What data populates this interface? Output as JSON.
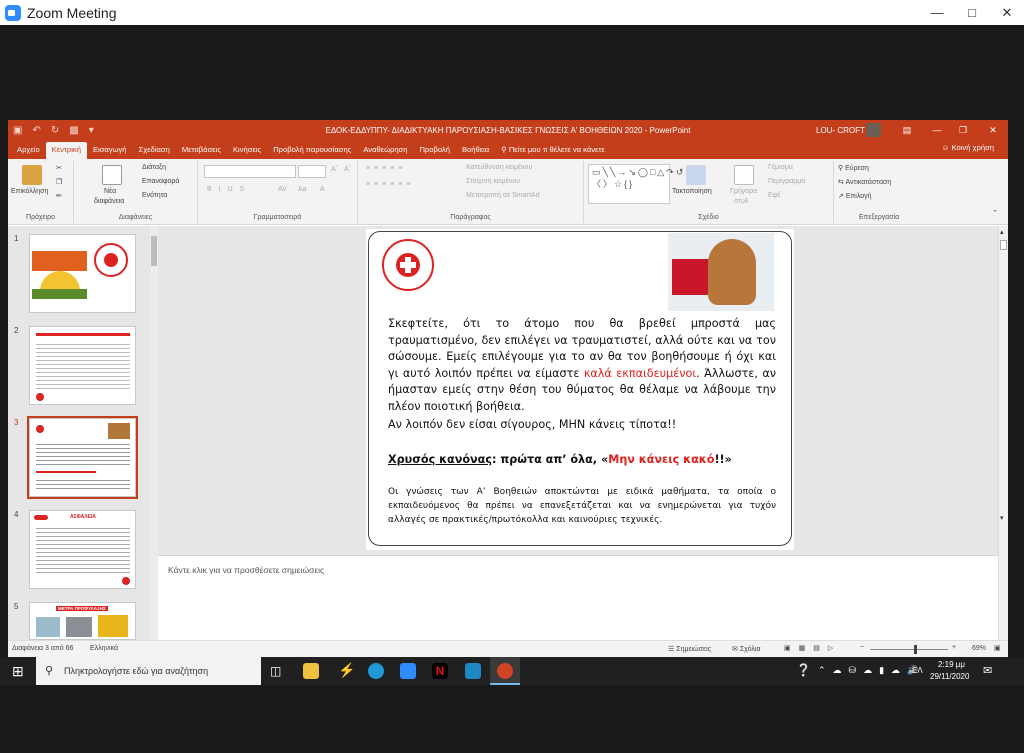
{
  "zoom": {
    "title": "Zoom Meeting"
  },
  "ppt": {
    "doc_title": "ΕΔΟΚ-ΕΔΔΥΠΠΥ- ΔΙΑΔΙΚΤΥΑΚΗ ΠΑΡΟΥΣΙΑΣΗ-ΒΑΣΙΚΕΣ ΓΝΩΣΕΙΣ Α' ΒΟΗΘΕΙΩΝ 2020  -  PowerPoint",
    "user": "LOU- CROFT",
    "tabs": [
      "Αρχείο",
      "Κεντρική",
      "Εισαγωγή",
      "Σχεδίαση",
      "Μεταβάσεις",
      "Κινήσεις",
      "Προβολή παρουσίασης",
      "Αναθεώρηση",
      "Προβολή",
      "Βοήθεια",
      "Πείτε μου τι θέλετε να κάνετε"
    ],
    "share": "Κοινή χρήση",
    "ribbon": {
      "clipboard": {
        "paste": "Επικόλληση",
        "label": "Πρόχειρο"
      },
      "slides": {
        "new": "Νέα",
        "new2": "διαφάνεια",
        "layout": "Διάταξη",
        "reset": "Επαναφορά",
        "section": "Ενότητα",
        "label": "Διαφάνειες"
      },
      "font": {
        "label": "Γραμματοσειρά"
      },
      "paragraph": {
        "text_direction": "Κατεύθυνση κειμένου",
        "align_text": "Στοίχιση κειμένου",
        "smartart": "Μετατροπή σε SmartArt",
        "label": "Παράγραφος"
      },
      "drawing": {
        "arrange": "Τακτοποίηση",
        "quick1": "Γρήγορα",
        "quick2": "στυλ",
        "fill": "Γέμισμα",
        "outline": "Περίγραμμα",
        "effects": "Εφέ",
        "label": "Σχέδιο"
      },
      "editing": {
        "find": "Εύρεση",
        "replace": "Αντικατάσταση",
        "select": "Επιλογή",
        "label": "Επεξεργασία"
      }
    },
    "thumb_numbers": [
      "1",
      "2",
      "3",
      "4",
      "5"
    ],
    "thumb4_title": "ΑΣΦΑΛΕΙΑ",
    "thumb5_title": "ΜΕΤΡΑ ΠΡΟΦΥΛΑΞΗΣ",
    "slide": {
      "p1_a": "Σκεφτείτε, ότι το άτομο που θα βρεθεί μπροστά μας τραυματισμένο, δεν επιλέγει να τραυματιστεί, αλλά ούτε και να τον σώσουμε. Εμείς επιλέγουμε για το αν θα τον βοηθήσουμε ή όχι και γι αυτό λοιπόν πρέπει να είμαστε ",
      "p1_red": "καλά εκπαιδευμένοι",
      "p1_b": ". Άλλωστε, αν ήμασταν εμείς στην θέση του θύματος θα θέλαμε να λάβουμε την πλέον ποιοτική βοήθεια.",
      "p1_c": "Αν λοιπόν δεν είσαι σίγουρος, ΜΗΝ κάνεις τίποτα!!",
      "rule_u": "Χρυσός κανόνας",
      "rule_a": ": πρώτα απ’ όλα, «",
      "rule_red": "Μην κάνεις κακό",
      "rule_b": "!!»",
      "p3": "Οι γνώσεις των Α’ Βοηθειών αποκτώνται  με ειδικά μαθήματα, τα οποία ο εκπαιδευόμενος θα πρέπει να επανεξετάζεται και να ενημερώνεται για τυχόν αλλαγές σε πρακτικές/πρωτόκολλα και καινούριες τεχνικές."
    },
    "notes_placeholder": "Κάντε κλικ για να προσθέσετε σημειώσεις",
    "status": {
      "slide": "Διαφάνεια 3 από 66",
      "lang": "Ελληνικά",
      "notes": "Σημειώσεις",
      "comments": "Σχόλια",
      "zoom": "69%"
    }
  },
  "taskbar": {
    "search_placeholder": "Πληκτρολογήστε εδώ για αναζήτηση",
    "lang": "ΕΛ",
    "time": "2:19 μμ",
    "date": "29/11/2020"
  },
  "colors": {
    "accent": "#c43e1c",
    "red_text": "#e0201a"
  }
}
